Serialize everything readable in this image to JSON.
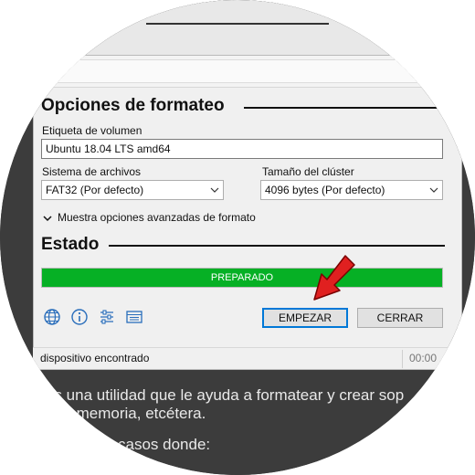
{
  "format_section": {
    "title": "Opciones de formateo",
    "volume_label_caption": "Etiqueta de volumen",
    "volume_label_value": "Ubuntu 18.04 LTS amd64",
    "filesystem_caption": "Sistema de archivos",
    "filesystem_value": "FAT32 (Por defecto)",
    "cluster_caption": "Tamaño del clúster",
    "cluster_value": "4096 bytes (Por defecto)",
    "advanced_toggle": "Muestra opciones avanzadas de formato"
  },
  "status_section": {
    "title": "Estado",
    "progress_text": "PREPARADO",
    "progress_fraction": 1.0,
    "progress_color": "#06b025"
  },
  "toolbar": {
    "icons": [
      "globe-icon",
      "info-icon",
      "settings-sliders-icon",
      "log-icon"
    ],
    "start_label": "EMPEZAR",
    "close_label": "CERRAR"
  },
  "statusbar": {
    "text": "dispositivo encontrado",
    "time": "00:00"
  },
  "background_text": {
    "line1": "es una utilidad que le ayuda a formatear y crear sop",
    "line2": "de memoria, etcétera.",
    "line3": "te útil en casos donde:"
  },
  "colors": {
    "accent_button_border": "#0078d7",
    "pointer_arrow": "#e02020"
  }
}
